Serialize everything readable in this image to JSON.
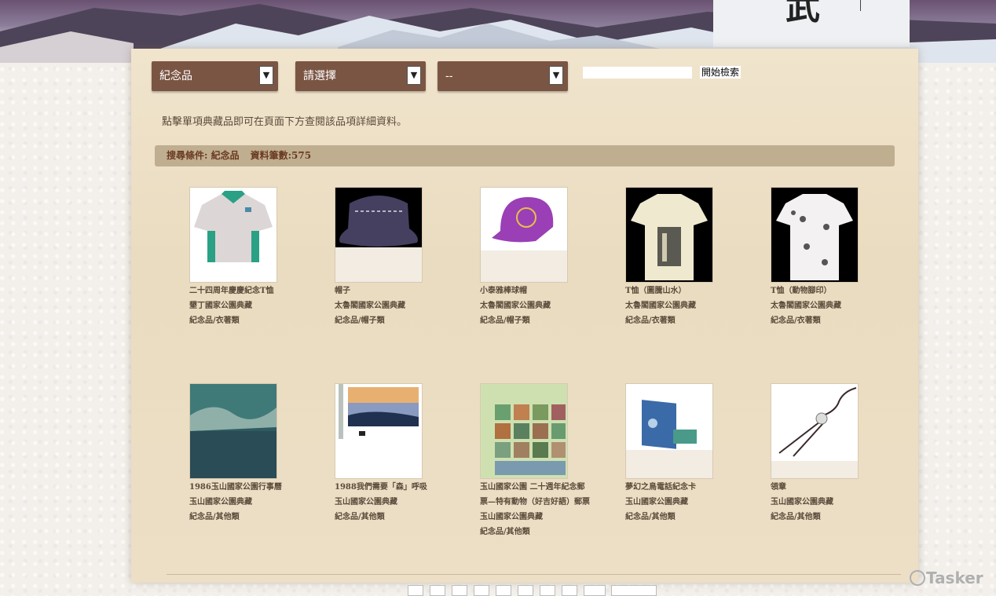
{
  "filters": {
    "category": "紀念品",
    "subcategory": "請選擇",
    "third": "--",
    "search_button": "開始檢索",
    "search_value": ""
  },
  "hint": "點擊單項典藏品即可在頁面下方查閱該品項詳細資料。",
  "condition": {
    "label": "搜尋條件: 紀念品",
    "count": "資料筆數:575"
  },
  "items": [
    {
      "title": "二十四周年慶慶紀念T恤",
      "collection": "墾丁國家公園典藏",
      "category": "紀念品/衣著類"
    },
    {
      "title": "帽子",
      "collection": "太魯閣國家公園典藏",
      "category": "紀念品/帽子類"
    },
    {
      "title": "小泰雅棒球帽",
      "collection": "太魯閣國家公園典藏",
      "category": "紀念品/帽子類"
    },
    {
      "title": "T恤（圖騰山水）",
      "collection": "太魯閣國家公園典藏",
      "category": "紀念品/衣著類"
    },
    {
      "title": "T恤（動物腳印）",
      "collection": "太魯閣國家公園典藏",
      "category": "紀念品/衣著類"
    },
    {
      "title": "1986玉山國家公園行事曆",
      "collection": "玉山國家公園典藏",
      "category": "紀念品/其他類"
    },
    {
      "title": "1988我們需要「森」呼吸",
      "collection": "玉山國家公園典藏",
      "category": "紀念品/其他類"
    },
    {
      "title": "玉山國家公園 二十週年紀念郵票—特有動物（好吉好語）郵票",
      "collection": "玉山國家公園典藏",
      "category": "紀念品/其他類"
    },
    {
      "title": "夢幻之鳥電話紀念卡",
      "collection": "玉山國家公園典藏",
      "category": "紀念品/其他類"
    },
    {
      "title": "領章",
      "collection": "玉山國家公園典藏",
      "category": "紀念品/其他類"
    }
  ],
  "watermark": "Tasker"
}
